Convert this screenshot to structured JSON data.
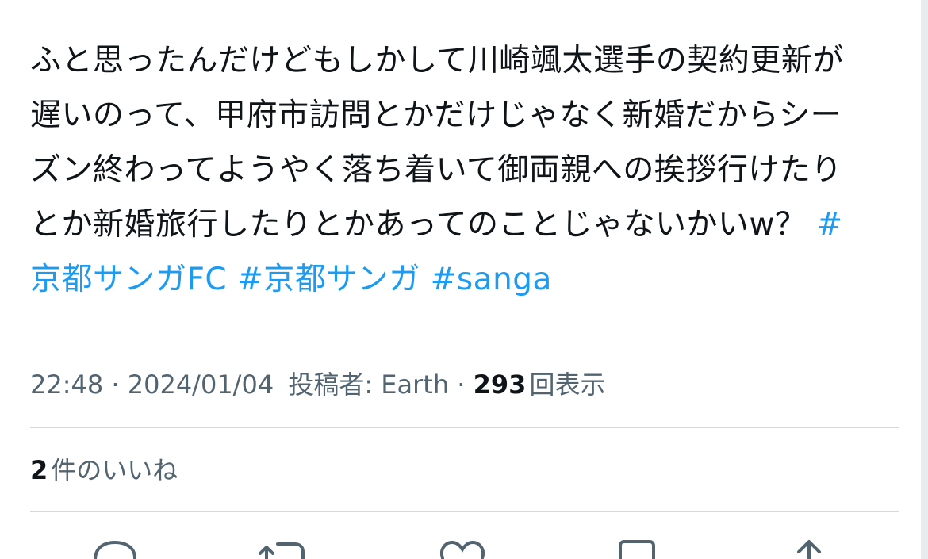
{
  "tweet": {
    "lines": [
      {
        "text": "ふと思ったんだけどもしかして川崎颯太選手の契約更新が"
      },
      {
        "text": "遅いのって、甲府市訪問とかだけじゃなく新婚だからシー"
      },
      {
        "text": "ズン終わってようやく落ち着いて御両親への挨拶行けたり"
      },
      {
        "text": "とか新婚旅行したりとかあってのことじゃないかいw？ ",
        "hashtag": "#"
      },
      {
        "hashtags": [
          "京都サンガFC",
          "#京都サンガ",
          "#sanga"
        ]
      }
    ]
  },
  "meta": {
    "time": "22:48",
    "separator": "·",
    "date": "2024/01/04",
    "author_label": "投稿者: Earth",
    "view_count": "293",
    "view_label": "回表示"
  },
  "likes": {
    "count": "2",
    "label": "件のいいね"
  },
  "actions": [
    {
      "icon": "reply-icon"
    },
    {
      "icon": "retweet-icon"
    },
    {
      "icon": "like-icon"
    },
    {
      "icon": "bookmark-icon"
    },
    {
      "icon": "share-icon"
    }
  ],
  "colors": {
    "text": "#0f1419",
    "secondary": "#536471",
    "link": "#1d9bf0",
    "divider": "#cfd9de"
  }
}
